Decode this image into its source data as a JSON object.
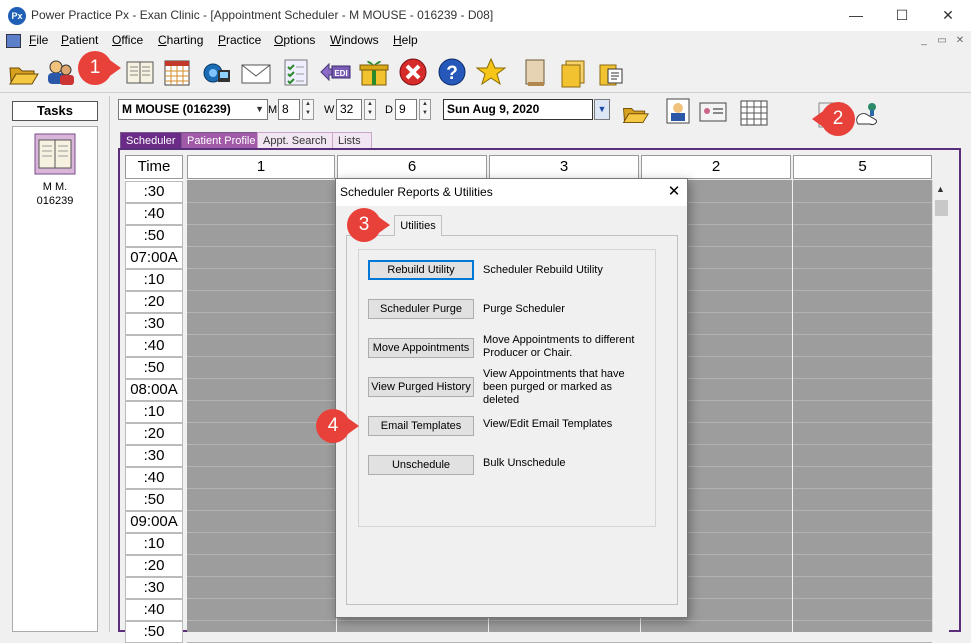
{
  "window": {
    "title": "Power Practice Px - Exan Clinic - [Appointment Scheduler - M MOUSE - 016239 - D08]",
    "logo_text": "Px",
    "minimize": "—",
    "maximize": "☐",
    "close": "✕"
  },
  "menu": {
    "items": [
      {
        "label": "File",
        "u": "F",
        "rest": "ile"
      },
      {
        "label": "Patient",
        "u": "P",
        "rest": "atient"
      },
      {
        "label": "Office",
        "u": "O",
        "rest": "ffice"
      },
      {
        "label": "Charting",
        "u": "C",
        "rest": "harting"
      },
      {
        "label": "Practice",
        "u": "P",
        "rest": "ractice"
      },
      {
        "label": "Options",
        "u": "O",
        "rest": "ptions"
      },
      {
        "label": "Windows",
        "u": "W",
        "rest": "indows"
      },
      {
        "label": "Help",
        "u": "H",
        "rest": "elp"
      }
    ],
    "mdi_minimize": "_",
    "mdi_restore": "▭",
    "mdi_close": "✕"
  },
  "tasks": {
    "label": "Tasks",
    "patient_name": "M M.",
    "patient_id": "016239"
  },
  "patient_bar": {
    "patient_select": "M MOUSE (016239)",
    "m_label": "M",
    "m_value": "8",
    "w_label": "W",
    "w_value": "32",
    "d_label": "D",
    "d_value": "9",
    "date_value": "Sun  Aug 9, 2020"
  },
  "tabs": [
    "Scheduler",
    "Patient Profile",
    "Appt. Search",
    "Lists"
  ],
  "schedule": {
    "time_header": "Time",
    "columns": [
      "1",
      "6",
      "3",
      "2",
      "5"
    ],
    "times": [
      ":30",
      ":40",
      ":50",
      "07:00A",
      ":10",
      ":20",
      ":30",
      ":40",
      ":50",
      "08:00A",
      ":10",
      ":20",
      ":30",
      ":40",
      ":50",
      "09:00A",
      ":10",
      ":20",
      ":30",
      ":40",
      ":50"
    ]
  },
  "dialog": {
    "title": "Scheduler Reports & Utilities",
    "close": "✕",
    "tab": "Utilities",
    "buttons": [
      {
        "label": "Rebuild Utility",
        "desc": "Scheduler Rebuild Utility"
      },
      {
        "label": "Scheduler Purge",
        "desc": "Purge Scheduler"
      },
      {
        "label": "Move Appointments",
        "desc": "Move Appointments to different Producer or Chair."
      },
      {
        "label": "View Purged History",
        "desc": "View Appointments that have been purged or marked as deleted"
      },
      {
        "label": "Email Templates",
        "desc": "View/Edit Email Templates"
      },
      {
        "label": "Unschedule",
        "desc": "Bulk Unschedule"
      }
    ]
  },
  "callouts": [
    "1",
    "2",
    "3",
    "4"
  ],
  "colors": {
    "callout_red": "#e8413a",
    "tab_purple": "#6a2c86",
    "grid_gray": "#9d9d9d"
  }
}
